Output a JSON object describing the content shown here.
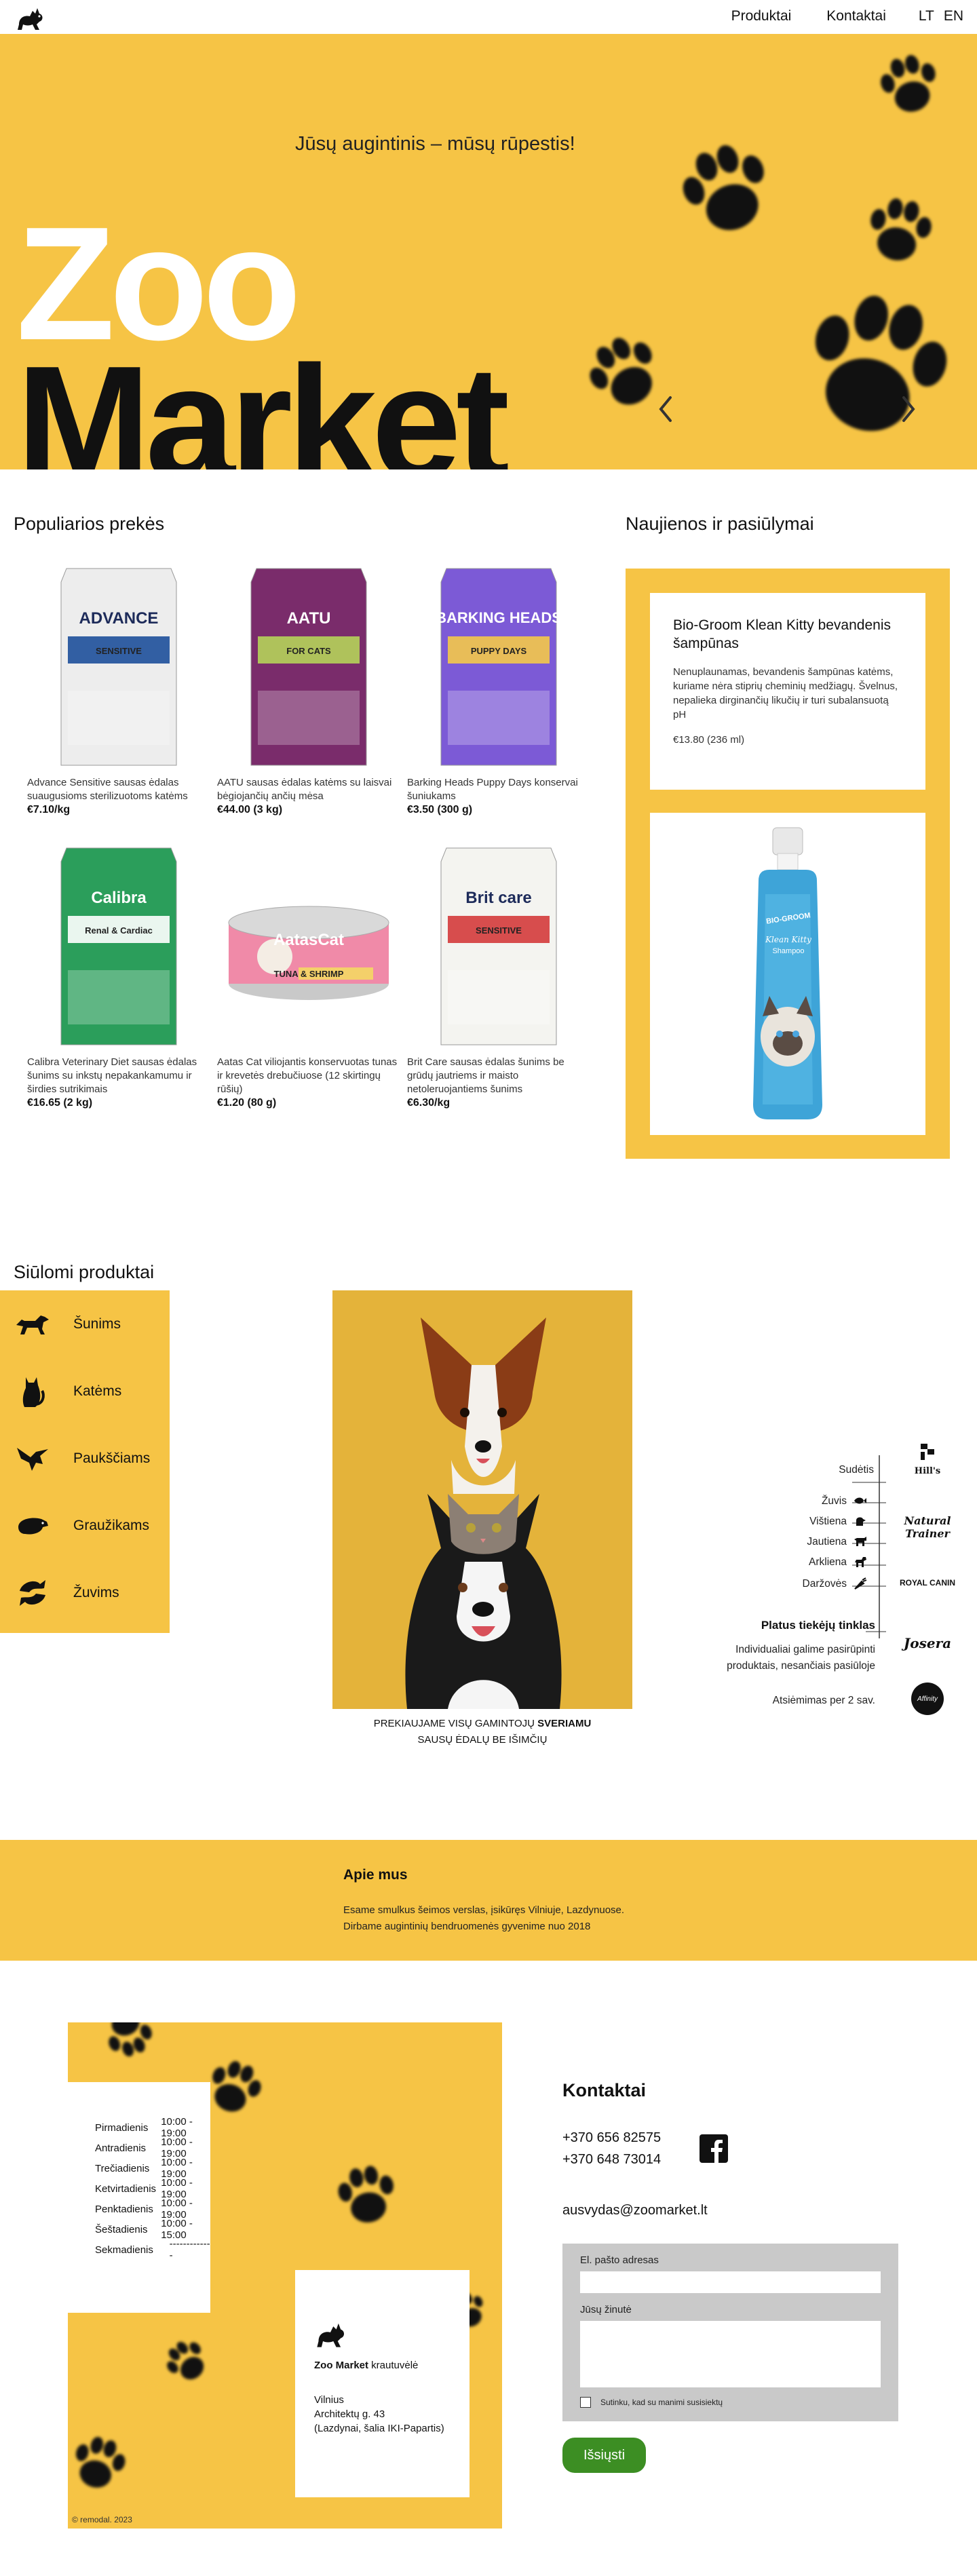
{
  "header": {
    "nav": [
      "Produktai",
      "Kontaktai"
    ],
    "languages": [
      "LT",
      "EN"
    ]
  },
  "hero": {
    "tagline": "Jūsų augintinis – mūsų rūpestis!",
    "title_line1": "Zoo",
    "title_line2": "Market"
  },
  "popular": {
    "title": "Populiarios prekės",
    "products": [
      {
        "name": "Advance Sensitive sausas ėdalas suaugusioms sterilizuotoms katėms",
        "price": "€7.10/kg",
        "brand": "ADVANCE",
        "sub": "SENSITIVE",
        "color": "#ededed",
        "accent": "#1d4f9a"
      },
      {
        "name": "AATU sausas ėdalas katėms su laisvai bėgiojančių ančių mėsa",
        "price": "€44.00 (3 kg)",
        "brand": "AATU",
        "sub": "FOR CATS",
        "color": "#7a2c6b",
        "accent": "#b5d35a"
      },
      {
        "name": "Barking Heads Puppy Days konservai šuniukams",
        "price": "€3.50 (300 g)",
        "brand": "BARKING HEADS",
        "sub": "PUPPY DAYS",
        "color": "#7c5ad6",
        "accent": "#f4c84a"
      },
      {
        "name": "Calibra Veterinary Diet sausas ėdalas šunims su inkstų nepakankamumu ir širdies sutrikimais",
        "price": "€16.65 (2 kg)",
        "brand": "Calibra",
        "sub": "Renal & Cardiac",
        "color": "#2b9e5b",
        "accent": "#ffffff"
      },
      {
        "name": "Aatas Cat viliojantis konservuotas tunas ir krevetės drebučiuose (12 skirtingų rūšių)",
        "price": "€1.20 (80 g)",
        "brand": "AatasCat",
        "sub": "TUNA & SHRIMP",
        "color": "#f08aa8",
        "accent": "#f4d06a"
      },
      {
        "name": "Brit Care sausas ėdalas šunims be grūdų jautriems ir maisto netoleruojantiems šunims",
        "price": "€6.30/kg",
        "brand": "Brit care",
        "sub": "SENSITIVE",
        "color": "#f4f4f0",
        "accent": "#d43b3b"
      }
    ]
  },
  "news": {
    "title": "Naujienos ir pasiūlymai",
    "card_title": "Bio-Groom Klean Kitty bevandenis šampūnas",
    "card_desc": "Nenuplaunamas, bevandenis šampūnas katėms, kuriame nėra stiprių cheminių medžiagų. Švelnus, nepalieka dirginančių likučių ir turi subalansuotą pH",
    "card_price": "€13.80 (236 ml)",
    "slide_brand": "BIO-GROOM",
    "slide_name": "Klean Kitty",
    "slide_sub": "Shampoo"
  },
  "offered": {
    "title": "Siūlomi produktai",
    "categories": [
      "Šunims",
      "Katėms",
      "Paukščiams",
      "Graužikams",
      "Žuvims"
    ],
    "caption_pre": "PREKIAUJAME VISŲ GAMINTOJŲ ",
    "caption_bold": "SVERIAMU",
    "caption_post": "SAUSŲ ĖDALŲ BE IŠIMČIŲ",
    "supplier_list": [
      "Sudėtis",
      "Žuvis",
      "Vištiena",
      "Jautiena",
      "Arkliena",
      "Daržovės"
    ],
    "network_title": "Platus tiekėjų tinklas",
    "network_text": "Individualiai galime pasirūpinti produktais, nesančiais pasiūloje",
    "weighing": "Atsiėmimas per 2 sav.",
    "brands": [
      "Hill's",
      "Natural Trainer",
      "ROYAL CANIN",
      "Josera",
      "Affinity"
    ]
  },
  "about": {
    "title": "Apie mus",
    "line1": "Esame smulkus šeimos verslas, įsikūręs Vilniuje, Lazdynuose.",
    "line2": "Dirbame augintinių bendruomenės gyvenime nuo 2018"
  },
  "hours": [
    {
      "day": "Pirmadienis",
      "time": "10:00 - 19:00"
    },
    {
      "day": "Antradienis",
      "time": "10:00 - 19:00"
    },
    {
      "day": "Trečiadienis",
      "time": "10:00 - 19:00"
    },
    {
      "day": "Ketvirtadienis",
      "time": "10:00 - 19:00"
    },
    {
      "day": "Penktadienis",
      "time": "10:00 - 19:00"
    },
    {
      "day": "Šeštadienis",
      "time": "10:00 - 15:00"
    },
    {
      "day": "Sekmadienis",
      "time": "-------------"
    }
  ],
  "shop": {
    "name_bold": "Zoo Market",
    "name_rest": " krautuvėlė",
    "city": "Vilnius",
    "street": "Architektų g. 43",
    "note": "(Lazdynai, šalia IKI-Papartis)"
  },
  "copyright": "© remodal. 2023",
  "contacts": {
    "title": "Kontaktai",
    "phone1": "+370 656 82575",
    "phone2": "+370 648 73014",
    "email": "ausvydas@zoomarket.lt",
    "form_email_label": "El. pašto adresas",
    "form_message_label": "Jūsų žinutė",
    "consent": "Sutinku, kad su manimi susisiektų",
    "submit": "Išsiųsti"
  },
  "colors": {
    "brand_yellow": "#f6c445",
    "button_green": "#3c8e23"
  }
}
